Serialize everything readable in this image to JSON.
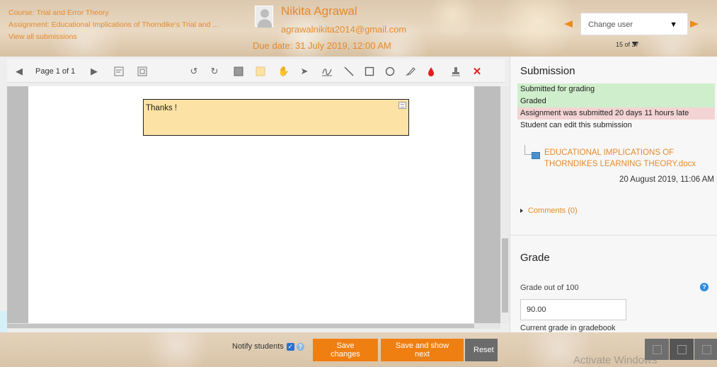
{
  "header": {
    "course_link": "Course: Trial and Error Theory",
    "assignment_link": "Assignment: Educational Implications of Thorndike's Trial and ...",
    "view_all_link": "View all submissions",
    "user_name": "Nikita Agrawal",
    "user_email": "agrawalnikita2014@gmail.com",
    "due_date": "Due date: 31 July 2019, 12:00 AM",
    "change_user_placeholder": "Change user",
    "user_count": "15 of 37"
  },
  "toolbar": {
    "page_label": "Page 1 of 1"
  },
  "document": {
    "comment_text": "Thanks !"
  },
  "side": {
    "title": "Submission",
    "status_submitted": "Submitted for grading",
    "status_graded": "Graded",
    "status_late": "Assignment was submitted 20 days 11 hours late",
    "status_edit": "Student can edit this submission",
    "file_name": "EDUCATIONAL IMPLICATIONS OF THORNDIKES LEARNING THEORY.docx",
    "file_date": "20 August 2019, 11:06 AM",
    "comments_link": "Comments (0)",
    "grade_title": "Grade",
    "grade_label": "Grade out of 100",
    "grade_value": "90.00",
    "gradebook_label": "Current grade in gradebook"
  },
  "footer": {
    "notify_label": "Notify students",
    "save_label": "Save changes",
    "save_next_label": "Save and show next",
    "reset_label": "Reset",
    "watermark": "Activate Windows"
  },
  "colors": {
    "accent": "#f07f12",
    "link": "#e58a2a",
    "status_green": "#cfeecb",
    "status_red": "#f3d3d3",
    "comment_bg": "#fde2a6"
  }
}
